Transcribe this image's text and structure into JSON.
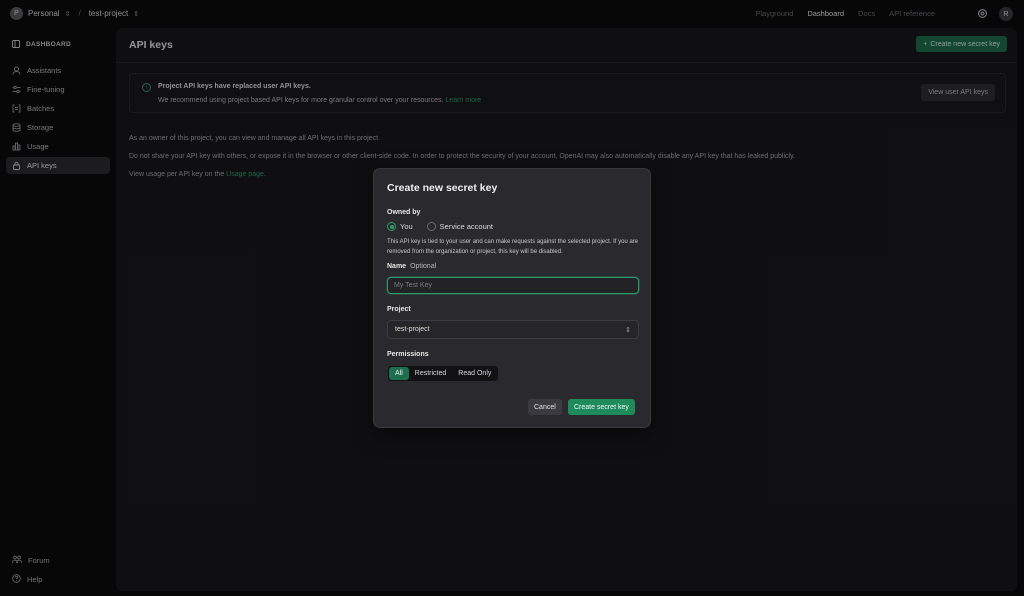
{
  "topbar": {
    "org_initial": "P",
    "org_name": "Personal",
    "project_name": "test-project",
    "nav": [
      "Playground",
      "Dashboard",
      "Docs",
      "API reference"
    ],
    "user_initial": "R"
  },
  "sidebar": {
    "header": "DASHBOARD",
    "items": [
      {
        "label": "Assistants",
        "icon": "assistant-icon"
      },
      {
        "label": "Fine-tuning",
        "icon": "sliders-icon"
      },
      {
        "label": "Batches",
        "icon": "batch-icon"
      },
      {
        "label": "Storage",
        "icon": "database-icon"
      },
      {
        "label": "Usage",
        "icon": "chart-icon"
      },
      {
        "label": "API keys",
        "icon": "lock-icon",
        "active": true
      }
    ],
    "footer": [
      {
        "label": "Forum",
        "icon": "people-icon"
      },
      {
        "label": "Help",
        "icon": "help-icon"
      }
    ]
  },
  "main": {
    "title": "API keys",
    "create_button": "Create new secret key",
    "banner": {
      "title": "Project API keys have replaced user API keys.",
      "text": "We recommend using project based API keys for more granular control over your resources.",
      "link": "Learn more",
      "button": "View user API keys"
    },
    "para1": "As an owner of this project, you can view and manage all API keys in this project.",
    "para2": "Do not share your API key with others, or expose it in the browser or other client-side code. In order to protect the security of your account, OpenAI may also automatically disable any API key that has leaked publicly.",
    "para3_prefix": "View usage per API key on the",
    "para3_link": "Usage page",
    "para3_suffix": "."
  },
  "modal": {
    "title": "Create new secret key",
    "owned_by_label": "Owned by",
    "owner_options": [
      "You",
      "Service account"
    ],
    "owner_selected": "You",
    "note": "This API key is tied to your user and can make requests against the selected project. If you are removed from the organization or project, this key will be disabled.",
    "name_label": "Name",
    "name_optional": "Optional",
    "name_placeholder": "My Test Key",
    "project_label": "Project",
    "project_value": "test-project",
    "permissions_label": "Permissions",
    "permission_options": [
      "All",
      "Restricted",
      "Read Only"
    ],
    "permission_selected": "All",
    "cancel": "Cancel",
    "submit": "Create secret key"
  },
  "colors": {
    "accent": "#1f8a5c",
    "background": "#0b0b0d",
    "panel": "#18181b",
    "modal": "#2a2a2e"
  }
}
